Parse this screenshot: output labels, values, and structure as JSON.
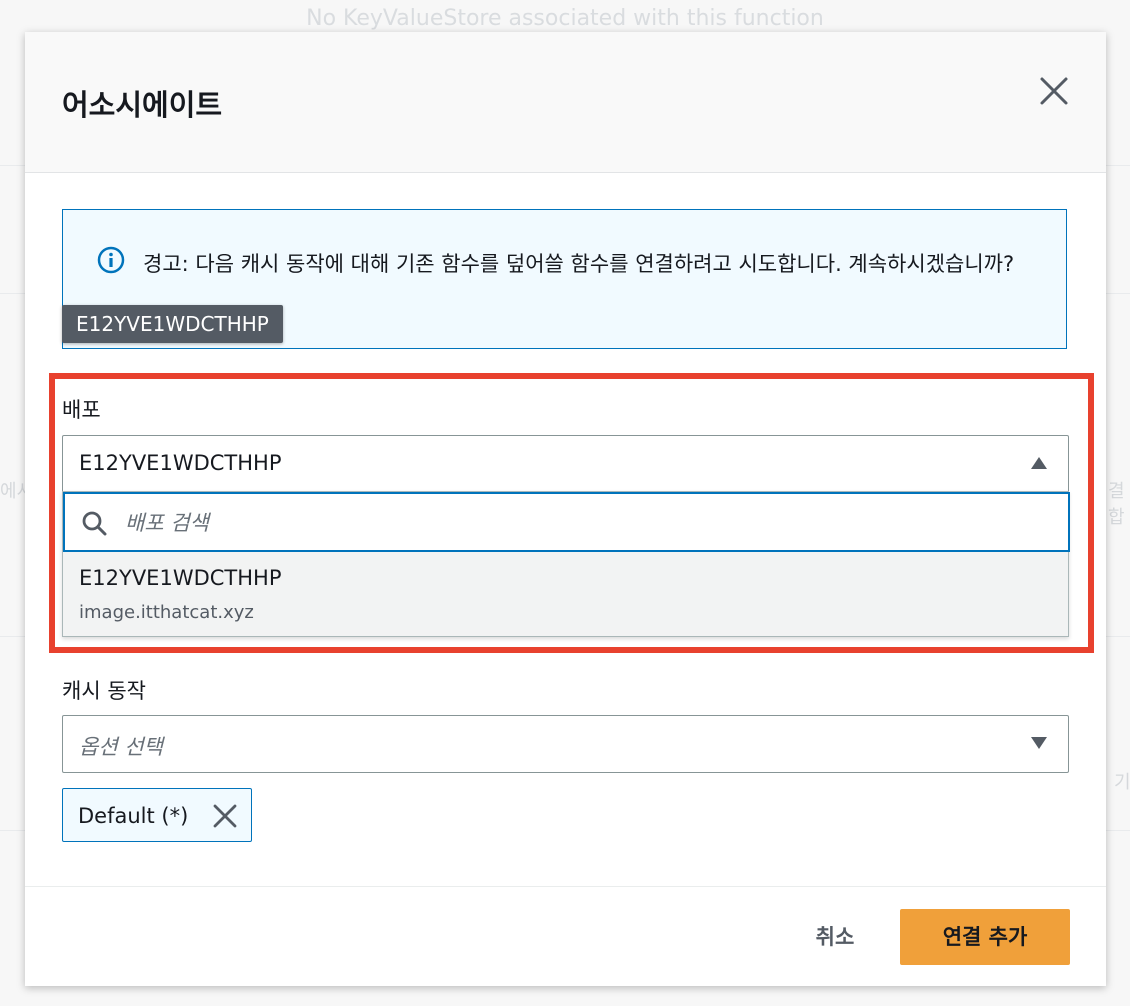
{
  "background": {
    "top_text": "No KeyValueStore associated with this function",
    "left_fragment": "에시",
    "right_fragment": "결합",
    "right_fragment_2": "기"
  },
  "modal": {
    "title": "어소시에이트",
    "close_icon": "close-icon"
  },
  "alert": {
    "icon": "info-icon",
    "text": "경고: 다음 캐시 동작에 대해 기존 함수를 덮어쓸 함수를 연결하려고 시도합니다. 계속하시겠습니까?"
  },
  "tooltip": {
    "text": "E12YVE1WDCTHHP"
  },
  "distribution_field": {
    "label": "배포",
    "selected_value": "E12YVE1WDCTHHP",
    "search_placeholder": "배포 검색",
    "options": [
      {
        "title": "E12YVE1WDCTHHP",
        "description": "image.itthatcat.xyz"
      }
    ]
  },
  "cache_behavior_field": {
    "label": "캐시 동작",
    "placeholder": "옵션 선택",
    "tokens": [
      {
        "label": "Default (*)"
      }
    ]
  },
  "footer": {
    "cancel_label": "취소",
    "submit_label": "연결 추가"
  },
  "colors": {
    "accent": "#0073bb",
    "primary_button": "#f0a03a",
    "highlight": "#e8412e",
    "alert_bg": "#f1faff"
  }
}
